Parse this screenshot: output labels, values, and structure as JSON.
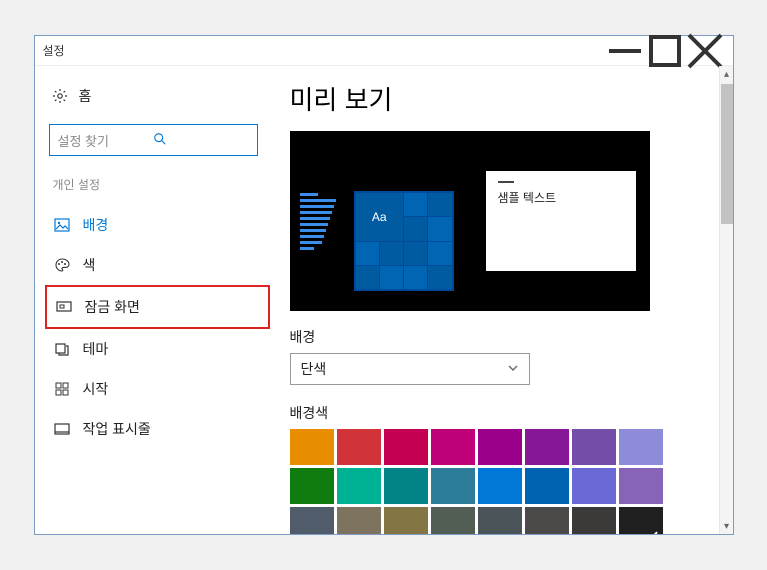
{
  "window": {
    "title": "설정"
  },
  "sidebar": {
    "home": "홈",
    "search_placeholder": "설정 찾기",
    "section": "개인 설정",
    "items": [
      {
        "label": "배경"
      },
      {
        "label": "색"
      },
      {
        "label": "잠금 화면"
      },
      {
        "label": "테마"
      },
      {
        "label": "시작"
      },
      {
        "label": "작업 표시줄"
      }
    ]
  },
  "content": {
    "title": "미리 보기",
    "preview": {
      "tile_text": "Aa",
      "sample_text": "샘플 텍스트"
    },
    "background_label": "배경",
    "background_select": "단색",
    "color_label": "배경색",
    "colors": [
      "#e88c00",
      "#d13438",
      "#c30052",
      "#bf0077",
      "#9a0089",
      "#881798",
      "#744da9",
      "#8e8cd8",
      "#107c10",
      "#00b294",
      "#038387",
      "#2d7d9a",
      "#0078d7",
      "#0063b1",
      "#6b69d6",
      "#8764b8",
      "#515c6b",
      "#7e735f",
      "#847545",
      "#525e54",
      "#4a5459",
      "#4c4a48",
      "#3b3a39",
      "#202020"
    ],
    "selected_color_index": 23
  }
}
